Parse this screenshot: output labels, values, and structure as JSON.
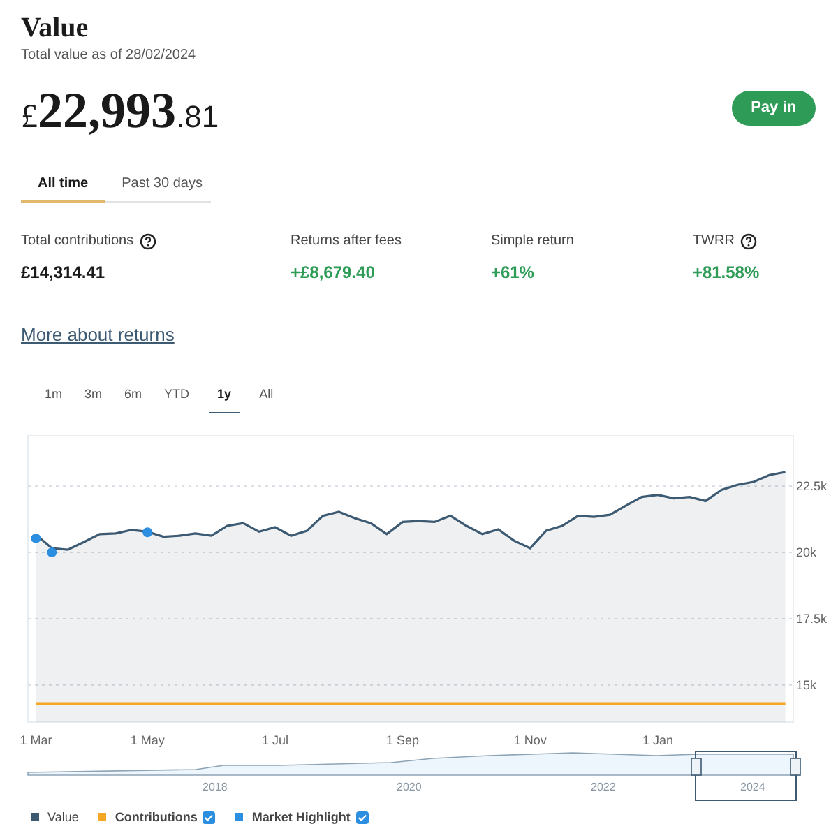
{
  "header": {
    "title": "Value",
    "subtitle": "Total value as of 28/02/2024",
    "currency": "£",
    "amount_main": "22,993",
    "amount_decimals": ".81",
    "action": "Pay in"
  },
  "period_tabs": [
    {
      "label": "All time",
      "selected": true
    },
    {
      "label": "Past 30 days",
      "selected": false
    }
  ],
  "stats": [
    {
      "label": "Total contributions",
      "help": true,
      "value": "£14,314.41",
      "positive": false
    },
    {
      "label": "Returns after fees",
      "help": false,
      "value": "+£8,679.40",
      "positive": true
    },
    {
      "label": "Simple return",
      "help": false,
      "value": "+61%",
      "positive": true
    },
    {
      "label": "TWRR",
      "help": true,
      "value": "+81.58%",
      "positive": true
    }
  ],
  "link": "More about returns",
  "range_tabs": [
    {
      "label": "1m",
      "selected": false
    },
    {
      "label": "3m",
      "selected": false
    },
    {
      "label": "6m",
      "selected": false
    },
    {
      "label": "YTD",
      "selected": false
    },
    {
      "label": "1y",
      "selected": true
    },
    {
      "label": "All",
      "selected": false
    }
  ],
  "chart": {
    "chart_data": {
      "type": "area",
      "grid": true,
      "categories": [
        "1 Mar",
        null,
        null,
        null,
        null,
        null,
        null,
        "1 May",
        null,
        null,
        null,
        null,
        null,
        null,
        null,
        "1 Jul",
        null,
        null,
        null,
        null,
        null,
        null,
        null,
        "1 Sep",
        null,
        null,
        null,
        null,
        null,
        null,
        null,
        "1 Nov",
        null,
        null,
        null,
        null,
        null,
        null,
        null,
        "1 Jan",
        null,
        null,
        null,
        null,
        null,
        null,
        null,
        null
      ],
      "series": [
        {
          "name": "Value",
          "color": "#3d5a73",
          "values": [
            20670,
            20160,
            20100,
            20390,
            20690,
            20720,
            20850,
            20780,
            20590,
            20630,
            20720,
            20630,
            21000,
            21100,
            20780,
            20950,
            20630,
            20820,
            21380,
            21530,
            21290,
            21100,
            20690,
            21150,
            21180,
            21150,
            21380,
            21000,
            20690,
            20870,
            20440,
            20160,
            20820,
            21000,
            21380,
            21340,
            21420,
            21760,
            22090,
            22170,
            22040,
            22090,
            21940,
            22360,
            22550,
            22660,
            22920,
            23030
          ]
        },
        {
          "name": "Contributions",
          "type": "line",
          "color": "#f5a623",
          "values": [
            14300,
            14300,
            14300,
            14300,
            14300,
            14300,
            14300,
            14300,
            14300,
            14300,
            14300,
            14300,
            14300,
            14300,
            14300,
            14300,
            14300,
            14300,
            14300,
            14300,
            14300,
            14300,
            14300,
            14300,
            14300,
            14300,
            14300,
            14300,
            14300,
            14300,
            14300,
            14300,
            14300,
            14300,
            14300,
            14300,
            14300,
            14300,
            14300,
            14300,
            14300,
            14300,
            14300,
            14300,
            14300,
            14300,
            14300,
            14300
          ]
        },
        {
          "name": "Market Highlight",
          "type": "scatter",
          "color": "#2b8ee0",
          "values": [
            20530,
            20000,
            null,
            null,
            null,
            null,
            null,
            20760,
            null,
            null,
            null,
            null,
            null,
            null,
            null,
            null,
            null,
            null,
            null,
            null,
            null,
            null,
            null,
            null,
            null,
            null,
            null,
            null,
            null,
            null,
            null,
            null,
            null,
            null,
            null,
            null,
            null,
            null,
            null,
            null,
            null,
            null,
            null,
            null,
            null,
            null,
            null,
            null
          ]
        }
      ],
      "ylim": [
        13600,
        24400
      ],
      "yticks": [
        {
          "value": 15000,
          "label": "15k"
        },
        {
          "value": 17500,
          "label": "17.5k"
        },
        {
          "value": 20000,
          "label": "20k"
        },
        {
          "value": 22500,
          "label": "22.5k"
        }
      ]
    },
    "navigator_labels": [
      "2018",
      "2020",
      "2022",
      "2024"
    ]
  },
  "legend": [
    {
      "kind": "series"
    },
    {
      "kind": "series",
      "checked": true
    },
    {
      "kind": "highlight",
      "checked": true
    }
  ]
}
